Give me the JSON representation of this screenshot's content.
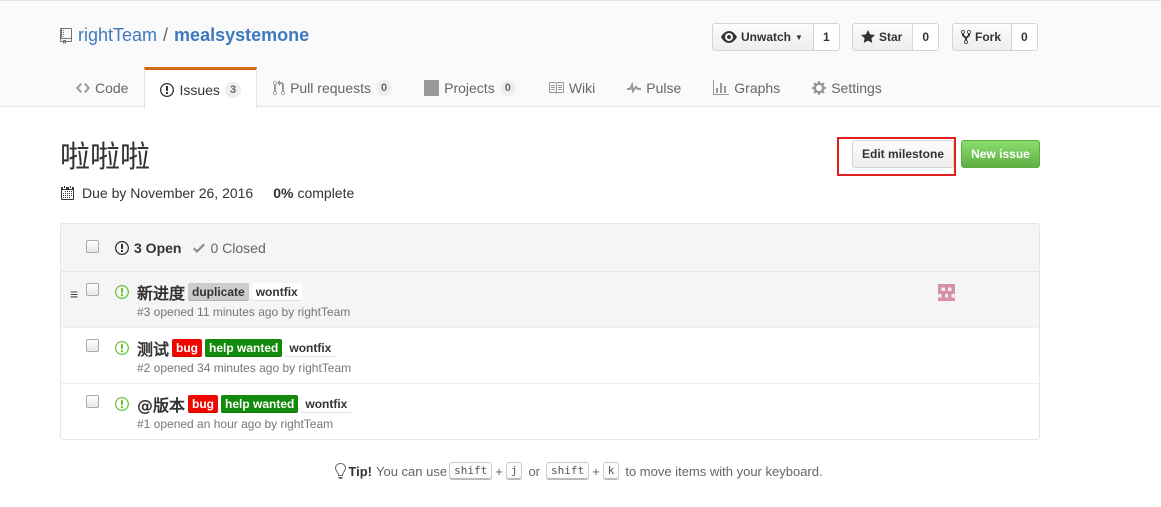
{
  "repo": {
    "owner": "rightTeam",
    "separator": "/",
    "name": "mealsystemone"
  },
  "actions": {
    "watch": {
      "label": "Unwatch",
      "count": "1"
    },
    "star": {
      "label": "Star",
      "count": "0"
    },
    "fork": {
      "label": "Fork",
      "count": "0"
    }
  },
  "tabs": [
    {
      "label": "Code",
      "icon": "code-icon",
      "counter": null
    },
    {
      "label": "Issues",
      "icon": "issue-opened-icon",
      "counter": "3",
      "selected": true
    },
    {
      "label": "Pull requests",
      "icon": "git-pull-request-icon",
      "counter": "0"
    },
    {
      "label": "Projects",
      "icon": "project-icon",
      "counter": "0"
    },
    {
      "label": "Wiki",
      "icon": "book-icon",
      "counter": null
    },
    {
      "label": "Pulse",
      "icon": "pulse-icon",
      "counter": null
    },
    {
      "label": "Graphs",
      "icon": "graph-icon",
      "counter": null
    },
    {
      "label": "Settings",
      "icon": "gear-icon",
      "counter": null
    }
  ],
  "milestone": {
    "title": "啦啦啦",
    "due": "Due by November 26, 2016",
    "percent": "0%",
    "complete_label": "complete",
    "edit_label": "Edit milestone",
    "new_issue_label": "New issue"
  },
  "issues_header": {
    "open": "3 Open",
    "closed": "0 Closed"
  },
  "issues": [
    {
      "title": "新进度",
      "meta": "#3 opened 11 minutes ago by rightTeam",
      "labels": [
        {
          "name": "duplicate",
          "bg": "#cccccc",
          "fg": "#333333"
        },
        {
          "name": "wontfix",
          "bg": "#ffffff",
          "fg": "#333333"
        }
      ]
    },
    {
      "title": "测试",
      "meta": "#2 opened 34 minutes ago by rightTeam",
      "labels": [
        {
          "name": "bug",
          "bg": "#ee0701",
          "fg": "#ffffff"
        },
        {
          "name": "help wanted",
          "bg": "#128a0c",
          "fg": "#ffffff"
        },
        {
          "name": "wontfix",
          "bg": "#ffffff",
          "fg": "#333333"
        }
      ]
    },
    {
      "title": "@版本",
      "meta": "#1 opened an hour ago by rightTeam",
      "labels": [
        {
          "name": "bug",
          "bg": "#ee0701",
          "fg": "#ffffff"
        },
        {
          "name": "help wanted",
          "bg": "#128a0c",
          "fg": "#ffffff"
        },
        {
          "name": "wontfix",
          "bg": "#ffffff",
          "fg": "#333333"
        }
      ]
    }
  ],
  "tip": {
    "strong": "Tip!",
    "text1": "You can use",
    "key_shift": "shift",
    "key_j": "j",
    "or": "or",
    "key_k": "k",
    "text2": "to move items with your keyboard."
  },
  "colors": {
    "link": "#4078c0",
    "tab_accent": "#d26911",
    "open_green": "#6cc644",
    "highlight_red": "#e0201f"
  }
}
